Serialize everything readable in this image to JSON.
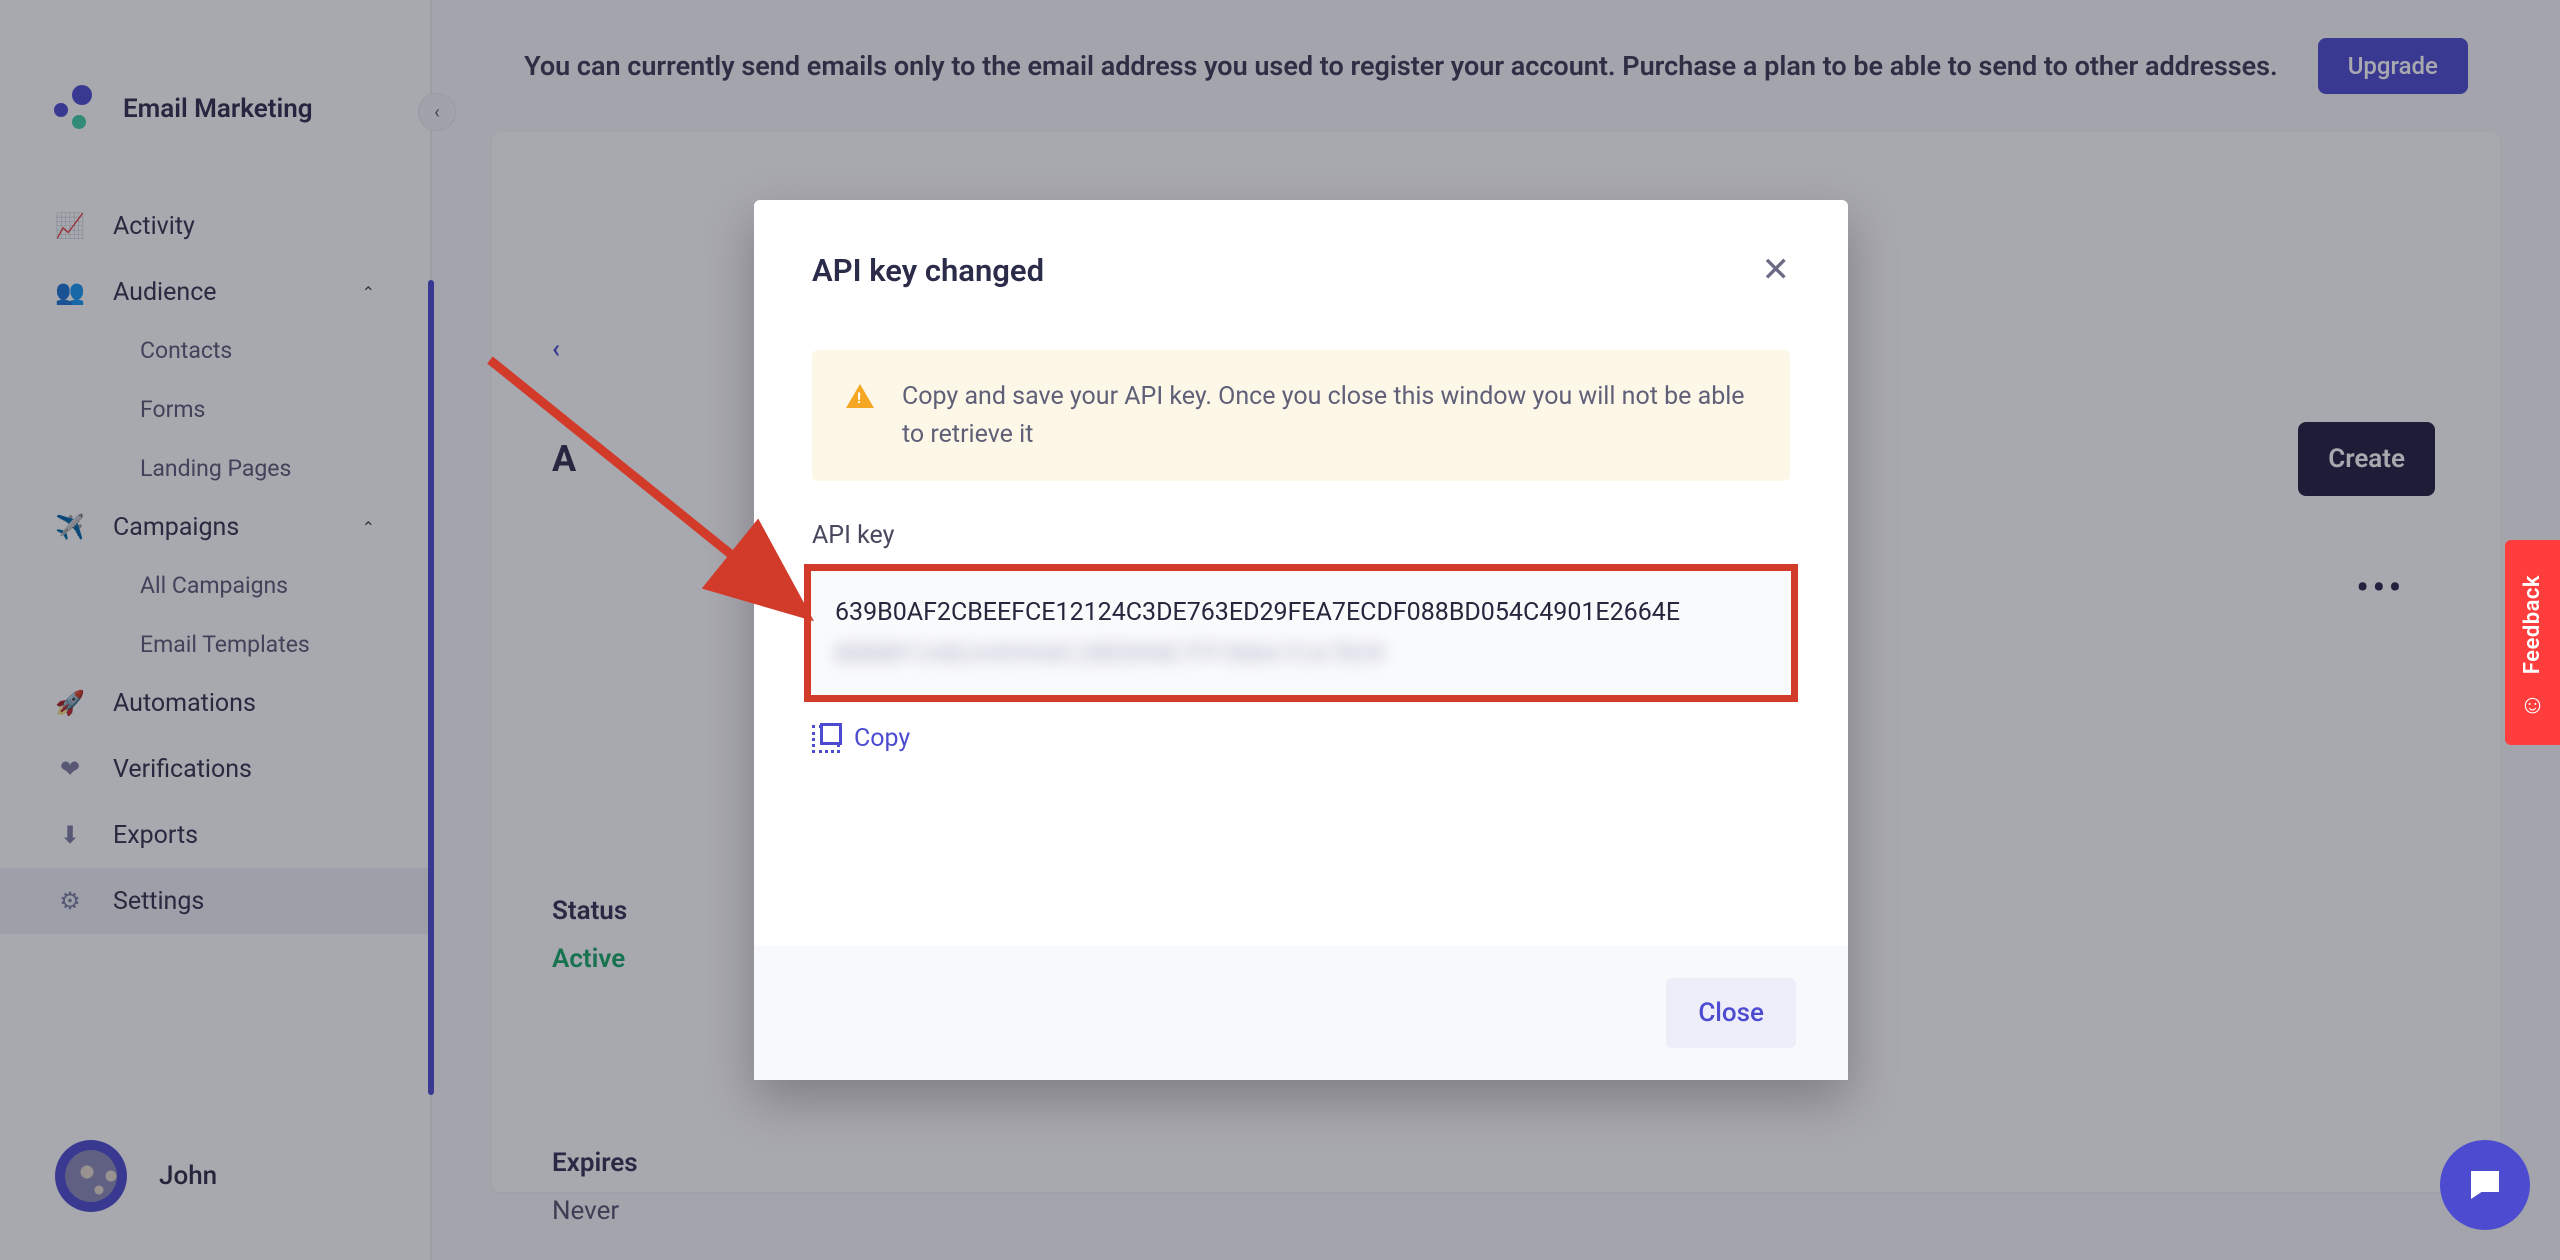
{
  "brand": {
    "title": "Email Marketing"
  },
  "nav": {
    "activity": "Activity",
    "audience": "Audience",
    "contacts": "Contacts",
    "forms": "Forms",
    "landing_pages": "Landing Pages",
    "campaigns": "Campaigns",
    "all_campaigns": "All Campaigns",
    "email_templates": "Email Templates",
    "automations": "Automations",
    "verifications": "Verifications",
    "exports": "Exports",
    "settings": "Settings"
  },
  "user": {
    "name": "John"
  },
  "banner": {
    "text": "You can currently send emails only to the email address you used to register your account. Purchase a plan to be able to send to other addresses.",
    "upgrade": "Upgrade"
  },
  "page": {
    "back": "‹",
    "title_initial": "A",
    "create": "Create",
    "status_label": "Status",
    "status_value": "Active",
    "expires_label": "Expires",
    "expires_value": "Never",
    "more": "•••"
  },
  "modal": {
    "title": "API key changed",
    "alert": "Copy and save your API key. Once you close this window you will not be able to retrieve it",
    "key_label": "API key",
    "key_value": "639B0AF2CBEEFCE12124C3DE763ED29FEA7ECDF088BD054C4901E2664E",
    "key_hidden": "BBBBFCAB2A9D968C2BEB98E7FF388A7CA7B39",
    "copy": "Copy",
    "close": "Close"
  },
  "feedback": {
    "label": "Feedback"
  }
}
